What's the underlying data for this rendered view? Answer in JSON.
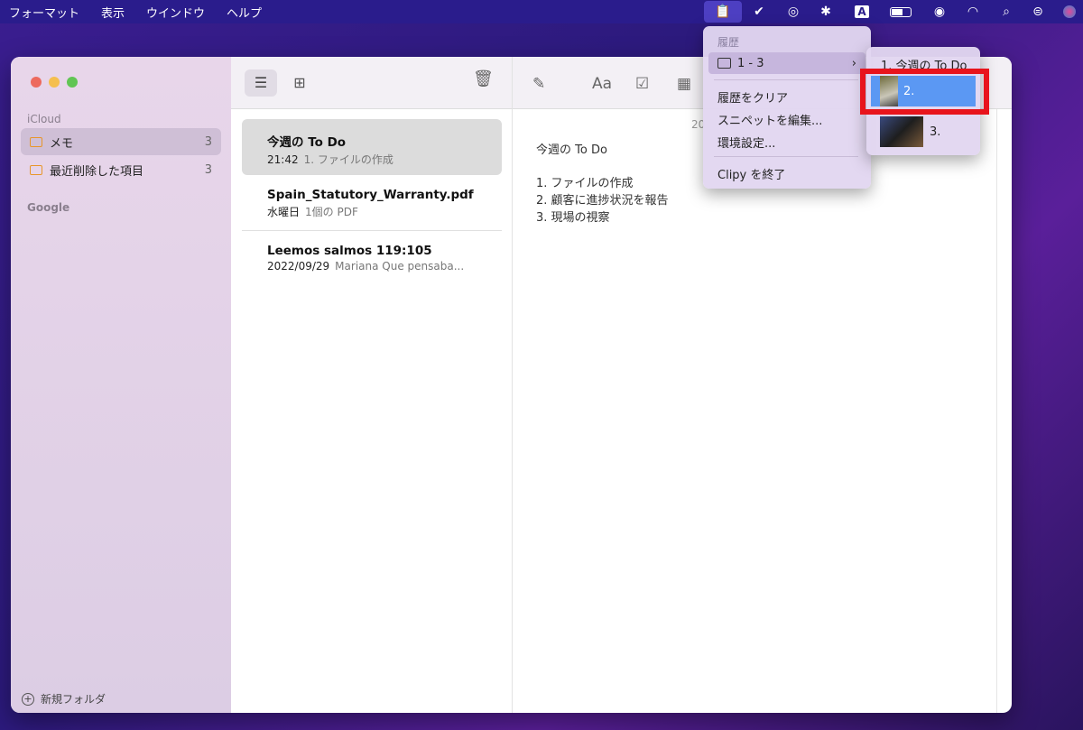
{
  "menubar": {
    "items": [
      "フォーマット",
      "表示",
      "ウインドウ",
      "ヘルプ"
    ]
  },
  "tray": [
    "clipy-icon",
    "checkmark-icon",
    "airdrop-icon",
    "bluetooth-icon",
    "input-icon",
    "battery-icon",
    "user-icon",
    "wifi-icon",
    "search-icon",
    "control-center-icon",
    "siri-icon"
  ],
  "tray_input_label": "A",
  "sidebar": {
    "icloud": "iCloud",
    "google": "Google",
    "items": [
      {
        "label": "メモ",
        "count": "3"
      },
      {
        "label": "最近削除した項目",
        "count": "3"
      }
    ],
    "new_folder": "新規フォルダ"
  },
  "notes": [
    {
      "title": "今週の To Do",
      "date": "21:42",
      "preview": "1. ファイルの作成"
    },
    {
      "title": "Spain_Statutory_Warranty.pdf",
      "date": "水曜日",
      "preview": "1個の PDF"
    },
    {
      "title": "Leemos salmos 119:105",
      "date": "2022/09/29",
      "preview": "Mariana Que pensaba..."
    }
  ],
  "editor": {
    "date_fragment": "20",
    "title": "今週の To Do",
    "lines": [
      "1. ファイルの作成",
      "2. 顧客に進捗状況を報告",
      "3. 現場の視察"
    ],
    "format_label": "Aa"
  },
  "clipy_menu": {
    "header": "履歴",
    "folder": "1 - 3",
    "clear": "履歴をクリア",
    "snippets": "スニペットを編集...",
    "prefs": "環境設定...",
    "quit": "Clipy を終了"
  },
  "submenu": {
    "items": [
      "1. 今週の To Do",
      "2.",
      "3."
    ],
    "selected": 1,
    "highlight_color": "#e8141c",
    "selection_color": "#5b98f3"
  }
}
